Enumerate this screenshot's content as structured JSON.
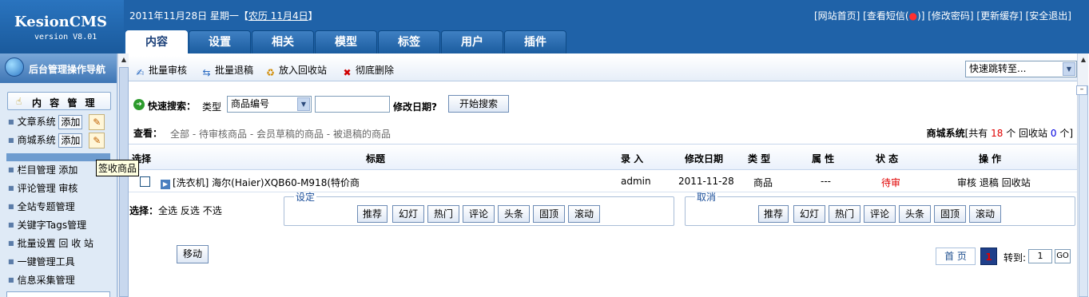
{
  "header": {
    "logo_name": "KesionCMS",
    "logo_version": "version V8.01",
    "date_text": "2011年11月28日 星期一【",
    "lunar_link": "农历 11月4日",
    "date_close": "】",
    "links": {
      "site_home": "[网站首页]",
      "messages_prefix": "[查看短信(",
      "messages_count": ")",
      "messages_suffix": "]",
      "change_password": "[修改密码]",
      "refresh_cache": "[更新缓存]",
      "logout": "[安全退出]"
    },
    "tabs": [
      "内容",
      "设置",
      "相关",
      "模型",
      "标签",
      "用户",
      "插件"
    ],
    "active_tab": "内容"
  },
  "sidebar": {
    "header_title": "后台管理操作导航",
    "section_title": "内 容 管 理",
    "article_system": "文章系统",
    "article_add": "添加",
    "mall_system": "商城系统",
    "mall_add": "添加",
    "tooltip": "签收商品",
    "column_manage": "栏目管理",
    "column_add": "添加",
    "comment_manage": "评论管理",
    "comment_review": "审核",
    "special_manage": "全站专题管理",
    "tags_manage": "关键字Tags管理",
    "batch_settings": "批量设置",
    "recycle": "回 收 站",
    "one_key": "一键管理工具",
    "collect": "信息采集管理"
  },
  "toolbar": {
    "batch_review": "批量审核",
    "batch_return": "批量退稿",
    "to_recycle": "放入回收站",
    "delete_all": "彻底删除",
    "quick_jump": "快速跳转至..."
  },
  "search": {
    "label": "快速搜索：",
    "type_label": "类型",
    "type_value": "商品编号",
    "modify_date_label": "修改日期?",
    "button": "开始搜索"
  },
  "filter": {
    "label": "查看：",
    "all": "全部",
    "pending": "待审核商品",
    "member_draft": "会员草稿的商品",
    "returned": "被退稿的商品",
    "sep": " - ",
    "stats_title": "商城系统",
    "stats_prefix": "[共有 ",
    "total": "18",
    "stats_mid": " 个 回收站 ",
    "recycle_count": "0",
    "stats_suffix": " 个]"
  },
  "table": {
    "headers": {
      "select": "选择",
      "title": "标题",
      "author": "录 入",
      "modified": "修改日期",
      "type": "类 型",
      "attr": "属 性",
      "status": "状 态",
      "ops": "操 作"
    },
    "rows": [
      {
        "title": "[洗衣机] 海尔(Haier)XQB60-M918(特价商",
        "author": "admin",
        "modified": "2011-11-28",
        "type": "商品",
        "attr": "---",
        "status": "待审",
        "op_review": "审核",
        "op_return": "退稿",
        "op_recycle": "回收站"
      }
    ]
  },
  "attributes": {
    "select_label": "选择：",
    "select_all": "全选",
    "invert": "反选",
    "none": "不选",
    "set_legend": "设定",
    "cancel_legend": "取消",
    "buttons": [
      "推荐",
      "幻灯",
      "热门",
      "评论",
      "头条",
      "固顶",
      "滚动"
    ]
  },
  "bottom": {
    "move": "移动",
    "first_page": "首 页",
    "current_page": "1",
    "goto_label": "转到:",
    "page_input": "1",
    "go": "GO"
  },
  "colors": {
    "header_blue": "#1f62a8",
    "status_red": "#e00000",
    "legend_blue": "#1b4f9a"
  }
}
